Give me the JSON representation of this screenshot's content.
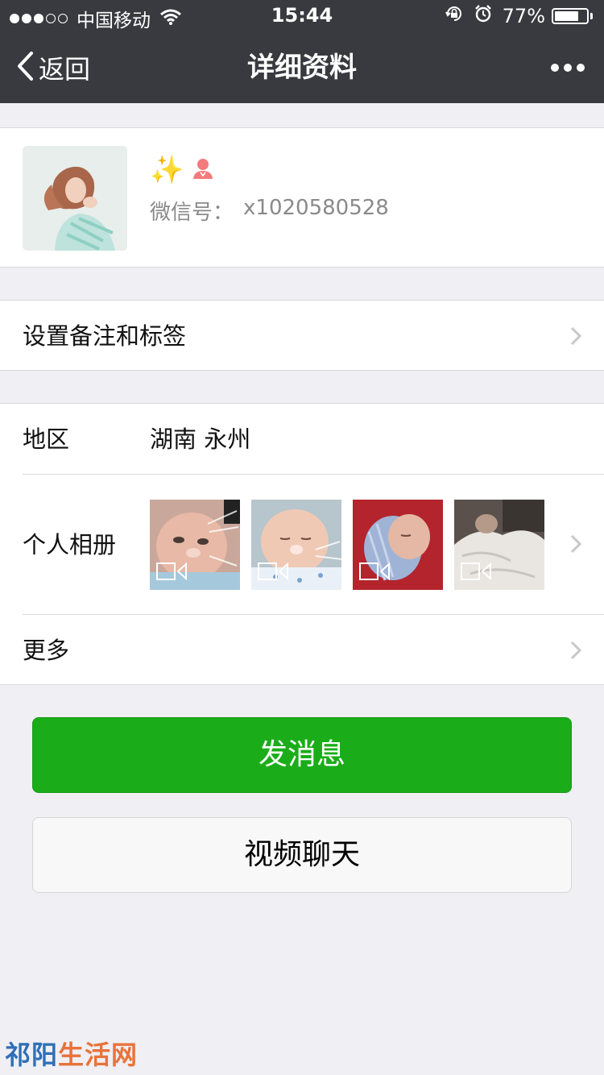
{
  "status_bar": {
    "carrier": "中国移动",
    "time": "15:44",
    "battery_percent": "77%",
    "battery_level": 0.77,
    "signal_bars": 3,
    "icons": [
      "wifi-icon",
      "rotation-lock-icon",
      "alarm-icon"
    ]
  },
  "nav": {
    "back_label": "返回",
    "title": "详细资料",
    "icons": [
      "back-chevron-icon",
      "more-dots-icon"
    ]
  },
  "profile": {
    "nickname_emoji": "✨",
    "gender": "female",
    "wechat_id_label": "微信号：",
    "wechat_id_value": "x1020580528"
  },
  "rows": {
    "remark_label": "设置备注和标签",
    "region_label": "地区",
    "region_value": "湖南 永州",
    "album_label": "个人相册",
    "more_label": "更多"
  },
  "album": {
    "thumbnails": [
      {
        "type": "video",
        "subject": "baby"
      },
      {
        "type": "video",
        "subject": "baby"
      },
      {
        "type": "video",
        "subject": "baby"
      },
      {
        "type": "video",
        "subject": "baby"
      }
    ]
  },
  "buttons": {
    "send_message": "发消息",
    "video_chat": "视频聊天"
  },
  "watermark": {
    "part1": "祁阳",
    "part2": "生活网"
  },
  "colors": {
    "nav_bg": "#393a3f",
    "primary_green": "#1aad19",
    "page_bg": "#efeff4",
    "female_icon": "#f37b7b"
  }
}
